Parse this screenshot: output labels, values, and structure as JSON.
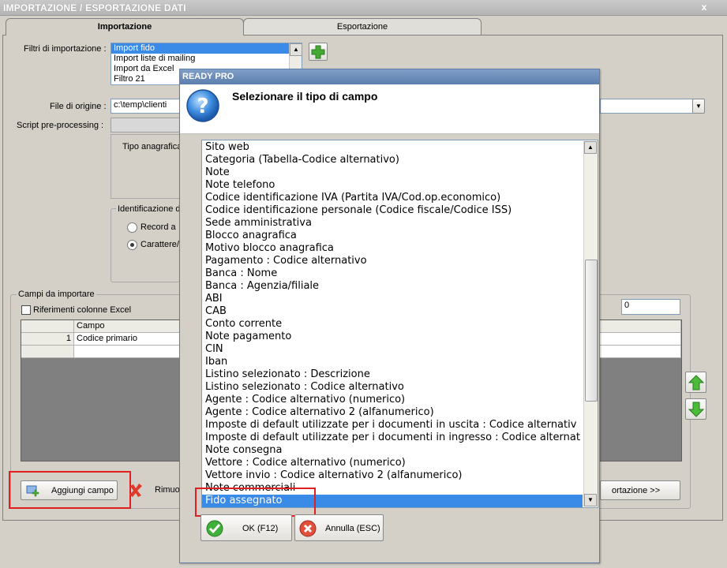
{
  "main": {
    "title": "IMPORTAZIONE / ESPORTAZIONE DATI",
    "close_glyph": "x",
    "tabs": [
      {
        "label": "Importazione"
      },
      {
        "label": "Esportazione"
      }
    ],
    "filters_label": "Filtri di importazione :",
    "filters": [
      "Import fido",
      "Import liste di mailing",
      "Import da Excel",
      "Filtro 21"
    ],
    "file_label": "File di origine :",
    "file_value": "c:\\temp\\clienti",
    "script_label": "Script pre-processing :",
    "tipo_label": "Tipo anagrafica",
    "ident_label": "Identificazione d",
    "radio_record": "Record a",
    "radio_carattere": "Carattere/",
    "campi_label": "Campi da importare",
    "riferimenti_label": "Riferimenti colonne Excel",
    "numeric_value": "0",
    "grid": {
      "header_campo": "Campo",
      "rows": [
        {
          "num": "1",
          "campo": "Codice primario"
        }
      ]
    },
    "add_field_button": "Aggiungi campo",
    "remove_button": "Rimuo",
    "import_button": "ortazione >>"
  },
  "dialog": {
    "title": "READY PRO",
    "heading": "Selezionare il tipo di campo",
    "fields": [
      "Sito web",
      "Categoria (Tabella-Codice alternativo)",
      "Note",
      "Note telefono",
      "Codice identificazione IVA (Partita IVA/Cod.op.economico)",
      "Codice identificazione personale (Codice fiscale/Codice ISS)",
      "Sede amministrativa",
      "Blocco anagrafica",
      "Motivo blocco anagrafica",
      "Pagamento : Codice alternativo",
      "Banca : Nome",
      "Banca : Agenzia/filiale",
      "ABI",
      "CAB",
      "Conto corrente",
      "Note pagamento",
      "CIN",
      "Iban",
      "Listino selezionato : Descrizione",
      "Listino selezionato : Codice alternativo",
      "Agente : Codice alternativo (numerico)",
      "Agente : Codice alternativo 2 (alfanumerico)",
      "Imposte di default utilizzate per i documenti in uscita : Codice alternativ",
      "Imposte di default utilizzate per i documenti in ingresso : Codice alternat",
      "Note consegna",
      "Vettore : Codice alternativo (numerico)",
      "Vettore invio : Codice alternativo 2 (alfanumerico)",
      "Note commerciali",
      "Fido assegnato"
    ],
    "selected_index": 28,
    "ok_button": "OK (F12)",
    "cancel_button": "Annulla (ESC)"
  },
  "colors": {
    "selection": "#3a8be8",
    "highlight": "#e02020",
    "dialog_title": "#5d7fae"
  }
}
